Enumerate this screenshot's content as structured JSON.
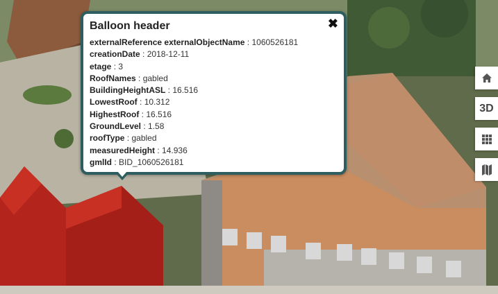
{
  "balloon": {
    "title": "Balloon header",
    "close_glyph": "✖",
    "attributes": [
      {
        "key": "externalReference externalObjectName",
        "value": "1060526181"
      },
      {
        "key": "creationDate",
        "value": "2018-12-11"
      },
      {
        "key": "etage",
        "value": "3"
      },
      {
        "key": "RoofNames",
        "value": "gabled"
      },
      {
        "key": "BuildingHeightASL",
        "value": "16.516"
      },
      {
        "key": "LowestRoof",
        "value": "10.312"
      },
      {
        "key": "HighestRoof",
        "value": "16.516"
      },
      {
        "key": "GroundLevel",
        "value": "1.58"
      },
      {
        "key": "roofType",
        "value": "gabled"
      },
      {
        "key": "measuredHeight",
        "value": "14.936"
      },
      {
        "key": "gmlId",
        "value": "BID_1060526181"
      }
    ],
    "separator": " : "
  },
  "toolbar": {
    "home_icon": "home-icon",
    "label_3d": "3D",
    "layers_icon": "grid-icon",
    "map_icon": "map-icon"
  },
  "colors": {
    "balloon_border": "#2e5e5f",
    "selected_building": "#b3241c"
  }
}
